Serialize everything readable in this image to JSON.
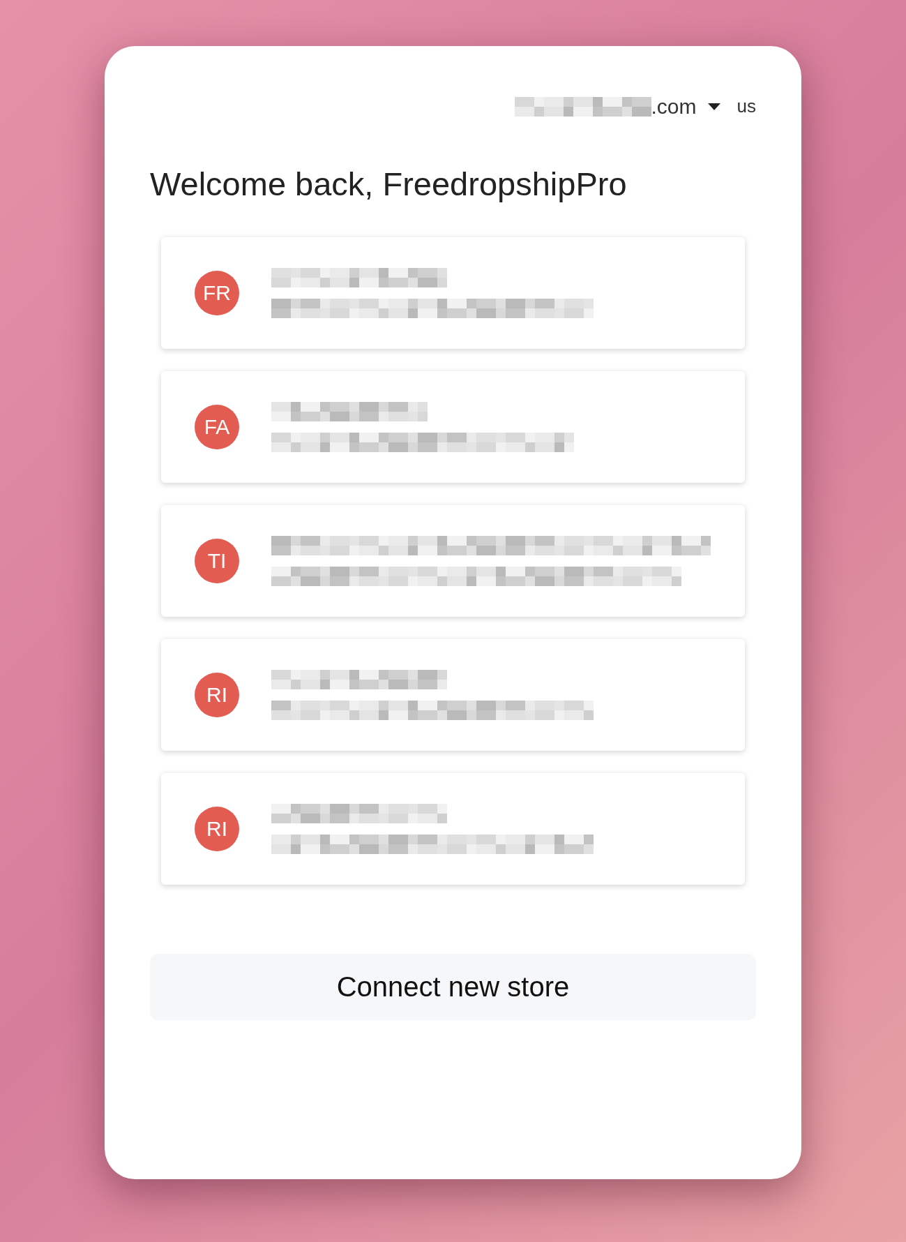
{
  "account": {
    "email_suffix": ".com",
    "region": "us"
  },
  "title": "Welcome back, FreedropshipPro",
  "stores": [
    {
      "initials": "FR"
    },
    {
      "initials": "FA"
    },
    {
      "initials": "TI"
    },
    {
      "initials": "RI"
    },
    {
      "initials": "RI"
    }
  ],
  "connect_button": "Connect new store"
}
